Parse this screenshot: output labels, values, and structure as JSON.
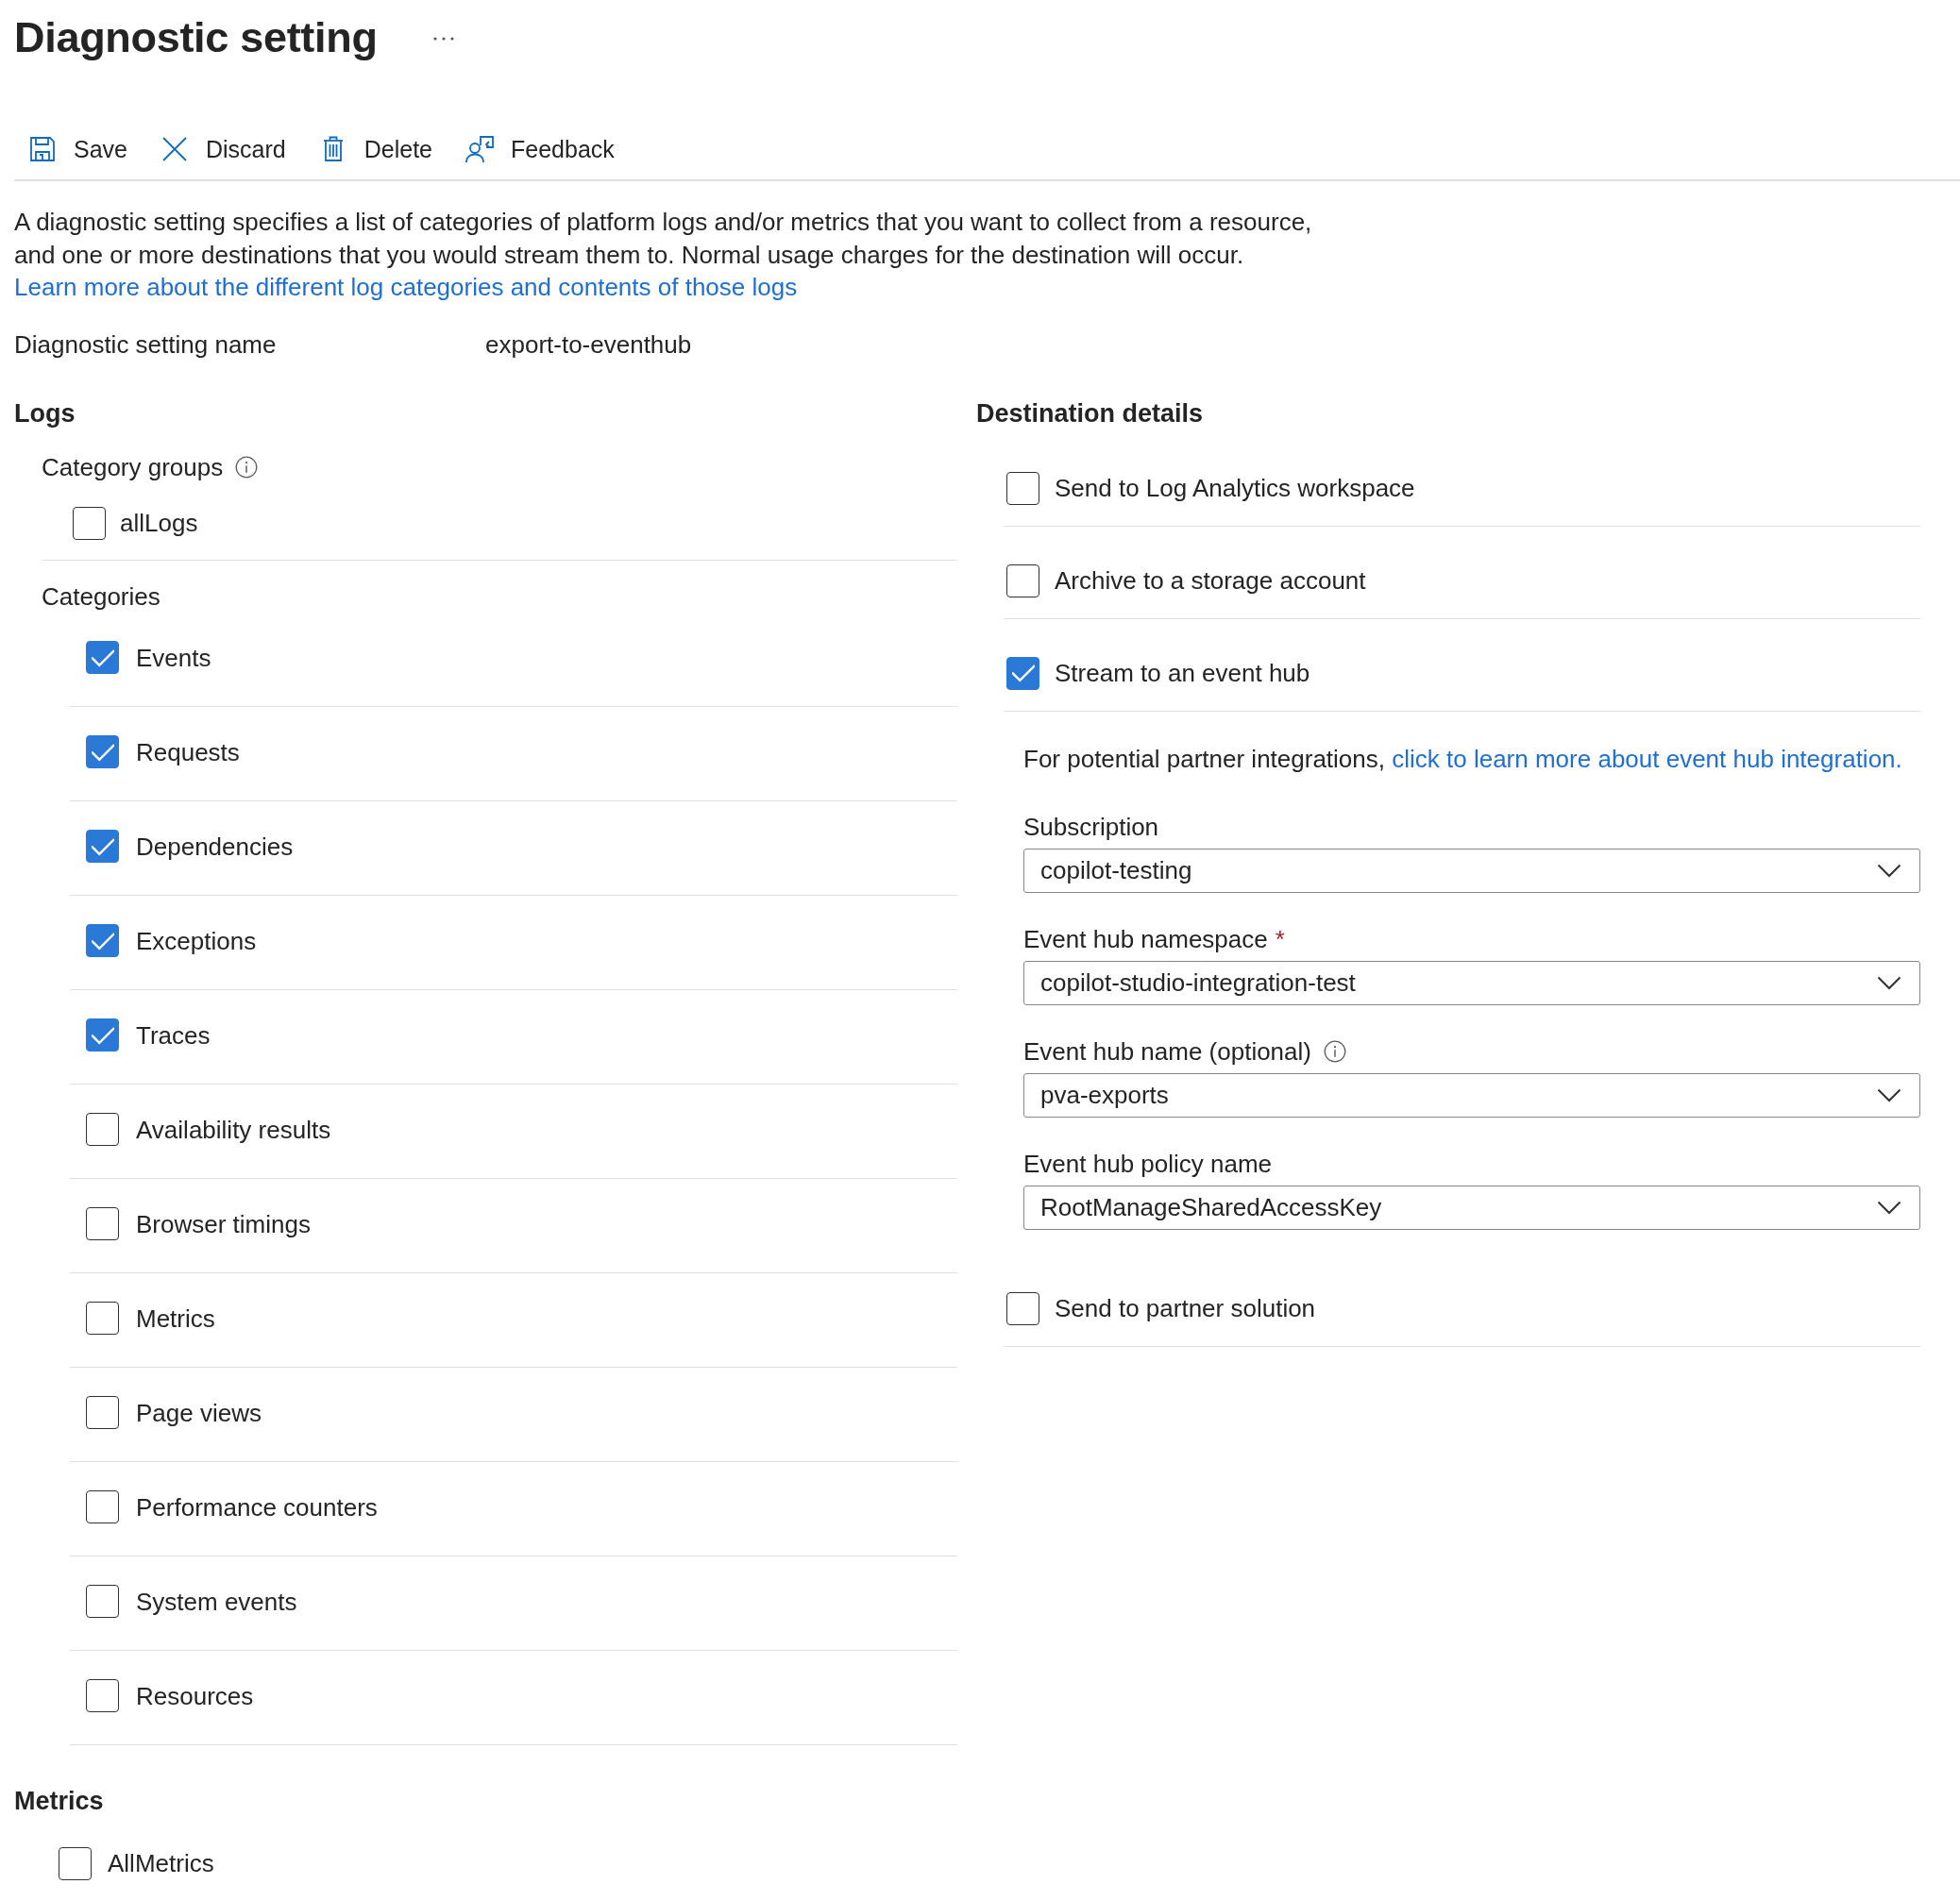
{
  "header": {
    "title": "Diagnostic setting"
  },
  "toolbar": [
    {
      "kind": "save",
      "label": "Save"
    },
    {
      "kind": "discard",
      "label": "Discard"
    },
    {
      "kind": "delete",
      "label": "Delete"
    },
    {
      "kind": "feedback",
      "label": "Feedback"
    }
  ],
  "description": {
    "text": "A diagnostic setting specifies a list of categories of platform logs and/or metrics that you want to collect from a resource, and one or more destinations that you would stream them to. Normal usage charges for the destination will occur.",
    "link": "Learn more about the different log categories and contents of those logs"
  },
  "setting_name": {
    "label": "Diagnostic setting name",
    "value": "export-to-eventhub"
  },
  "logs": {
    "title": "Logs",
    "category_groups": {
      "label": "Category groups",
      "info": true,
      "items": [
        {
          "label": "allLogs",
          "checked": false
        }
      ]
    },
    "categories": {
      "label": "Categories",
      "items": [
        {
          "label": "Events",
          "checked": true
        },
        {
          "label": "Requests",
          "checked": true
        },
        {
          "label": "Dependencies",
          "checked": true
        },
        {
          "label": "Exceptions",
          "checked": true
        },
        {
          "label": "Traces",
          "checked": true
        },
        {
          "label": "Availability results",
          "checked": false
        },
        {
          "label": "Browser timings",
          "checked": false
        },
        {
          "label": "Metrics",
          "checked": false
        },
        {
          "label": "Page views",
          "checked": false
        },
        {
          "label": "Performance counters",
          "checked": false
        },
        {
          "label": "System events",
          "checked": false
        },
        {
          "label": "Resources",
          "checked": false
        }
      ]
    }
  },
  "metrics": {
    "title": "Metrics",
    "items": [
      {
        "label": "AllMetrics",
        "checked": false
      }
    ]
  },
  "destination": {
    "title": "Destination details",
    "options": [
      {
        "label": "Send to Log Analytics workspace",
        "checked": false
      },
      {
        "label": "Archive to a storage account",
        "checked": false
      },
      {
        "label": "Stream to an event hub",
        "checked": true
      }
    ],
    "partner_note": {
      "text": "For potential partner integrations,",
      "link": "click to learn more about event hub integration."
    },
    "fields": [
      {
        "label": "Subscription",
        "info": false,
        "value": "copilot-testing"
      },
      {
        "label": "Event hub namespace",
        "required_mark": "*",
        "info": false,
        "value": "copilot-studio-integration-test"
      },
      {
        "label": "Event hub name (optional)",
        "info": true,
        "value": "pva-exports"
      },
      {
        "label": "Event hub policy name",
        "info": false,
        "value": "RootManageSharedAccessKey"
      }
    ],
    "partner_option": {
      "label": "Send to partner solution",
      "checked": false
    }
  }
}
